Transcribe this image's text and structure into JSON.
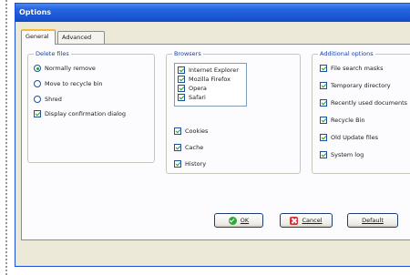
{
  "window": {
    "title": "Options"
  },
  "tabs": [
    {
      "label": "General",
      "active": true
    },
    {
      "label": "Advanced",
      "active": false
    }
  ],
  "delete_files": {
    "title": "Delete files",
    "options": [
      {
        "label": "Normally remove",
        "selected": true
      },
      {
        "label": "Move to recycle bin",
        "selected": false
      },
      {
        "label": "Shred",
        "selected": false
      }
    ],
    "confirm": {
      "label": "Display confirmation dialog",
      "checked": true
    }
  },
  "browsers": {
    "title": "Browsers",
    "list": [
      {
        "label": "Internet Explorer",
        "checked": true
      },
      {
        "label": "Mozilla Firefox",
        "checked": true
      },
      {
        "label": "Opera",
        "checked": true
      },
      {
        "label": "Safari",
        "checked": true
      }
    ],
    "options": [
      {
        "label": "Cookies",
        "checked": true
      },
      {
        "label": "Cache",
        "checked": true
      },
      {
        "label": "History",
        "checked": true
      }
    ]
  },
  "additional": {
    "title": "Additional options",
    "options": [
      {
        "label": "File search masks",
        "checked": true
      },
      {
        "label": "Temporary directory",
        "checked": true
      },
      {
        "label": "Recently used documents",
        "checked": true
      },
      {
        "label": "Recycle Bin",
        "checked": true
      },
      {
        "label": "Old Update files",
        "checked": true
      },
      {
        "label": "System log",
        "checked": true
      }
    ]
  },
  "buttons": {
    "ok": "OK",
    "cancel": "Cancel",
    "default": "Default"
  },
  "colors": {
    "titlebar": "#1a58d6",
    "dialog_bg": "#ece9d8",
    "group_title": "#1d3f9c",
    "check_mark": "#21a121"
  }
}
